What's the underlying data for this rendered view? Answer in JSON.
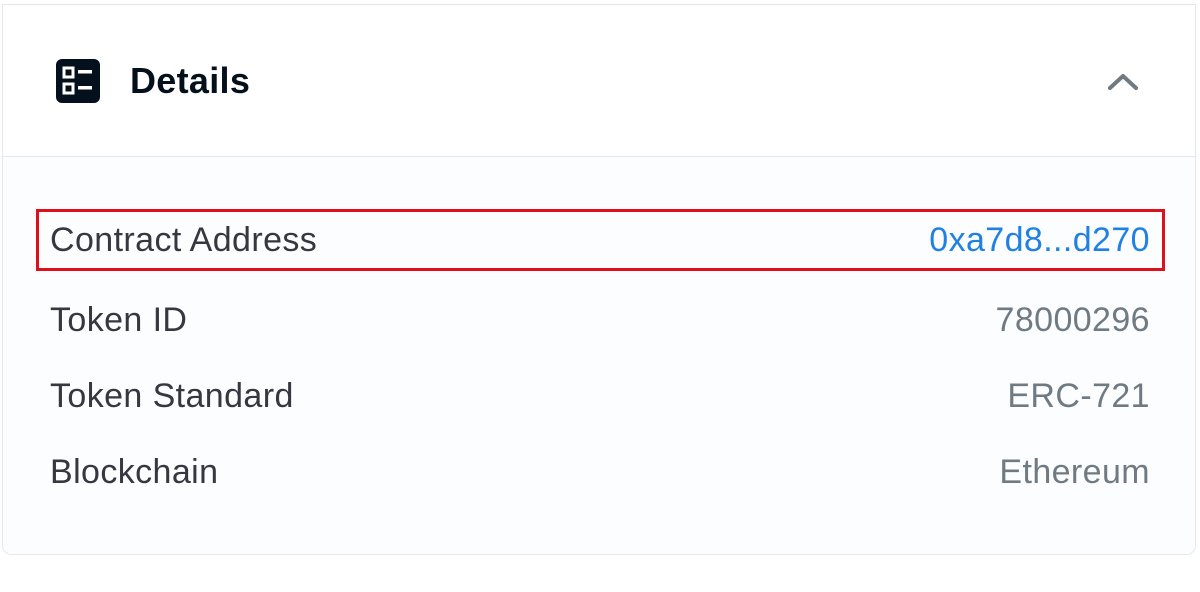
{
  "details": {
    "title": "Details",
    "icon": "details-list-icon",
    "toggle_icon": "chevron-up-icon",
    "rows": [
      {
        "label": "Contract Address",
        "value": "0xa7d8...d270",
        "is_link": true
      },
      {
        "label": "Token ID",
        "value": "78000296",
        "is_link": false
      },
      {
        "label": "Token Standard",
        "value": "ERC-721",
        "is_link": false
      },
      {
        "label": "Blockchain",
        "value": "Ethereum",
        "is_link": false
      }
    ]
  },
  "colors": {
    "link": "#2081e2",
    "highlight_border": "#e0101a",
    "label_text": "#353840",
    "value_text": "#707a83",
    "title_text": "#04111d"
  }
}
